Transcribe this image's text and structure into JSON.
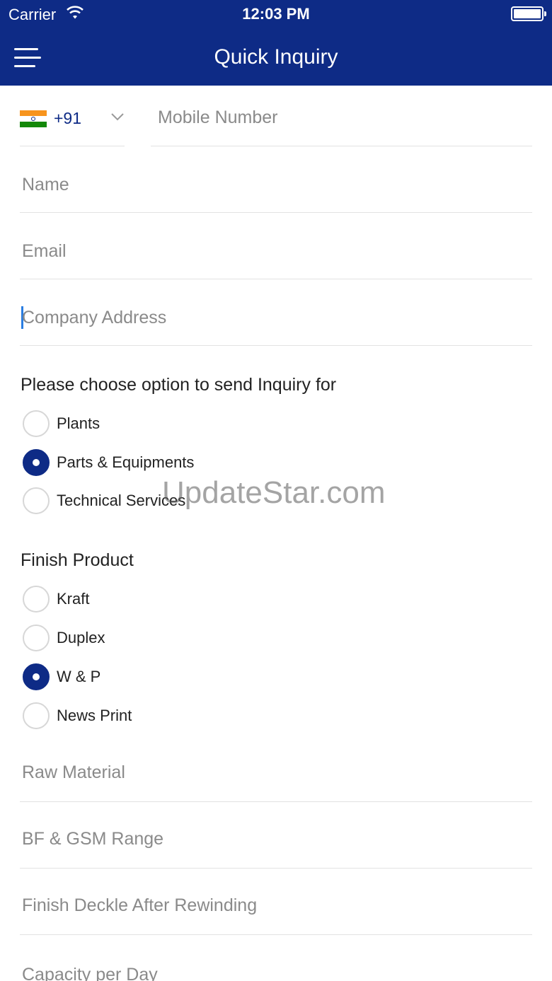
{
  "status_bar": {
    "carrier": "Carrier",
    "time": "12:03 PM"
  },
  "header": {
    "title": "Quick Inquiry",
    "menu_icon": "hamburger-menu-icon"
  },
  "colors": {
    "primary": "#0e2b86",
    "caret": "#2a7de1",
    "divider": "#e2e2e2",
    "placeholder": "#8a8a8a"
  },
  "phone": {
    "country_code": "+91",
    "flag_icon": "india-flag-icon",
    "mobile_placeholder": "Mobile Number"
  },
  "form": {
    "name_placeholder": "Name",
    "email_placeholder": "Email",
    "address_placeholder": "Company Address",
    "raw_material_placeholder": "Raw Material",
    "bf_gsm_placeholder": "BF & GSM Range",
    "deckle_placeholder": "Finish Deckle After Rewinding",
    "capacity_placeholder": "Capacity per Day"
  },
  "inquiry_section": {
    "title": "Please choose option to send Inquiry for",
    "options": [
      {
        "label": "Plants",
        "selected": false
      },
      {
        "label": "Parts & Equipments",
        "selected": true
      },
      {
        "label": "Technical Services",
        "selected": false
      }
    ]
  },
  "finish_section": {
    "title": "Finish Product",
    "options": [
      {
        "label": "Kraft",
        "selected": false
      },
      {
        "label": "Duplex",
        "selected": false
      },
      {
        "label": "W & P",
        "selected": true
      },
      {
        "label": "News Print",
        "selected": false
      }
    ]
  },
  "watermark": "UpdateStar.com"
}
